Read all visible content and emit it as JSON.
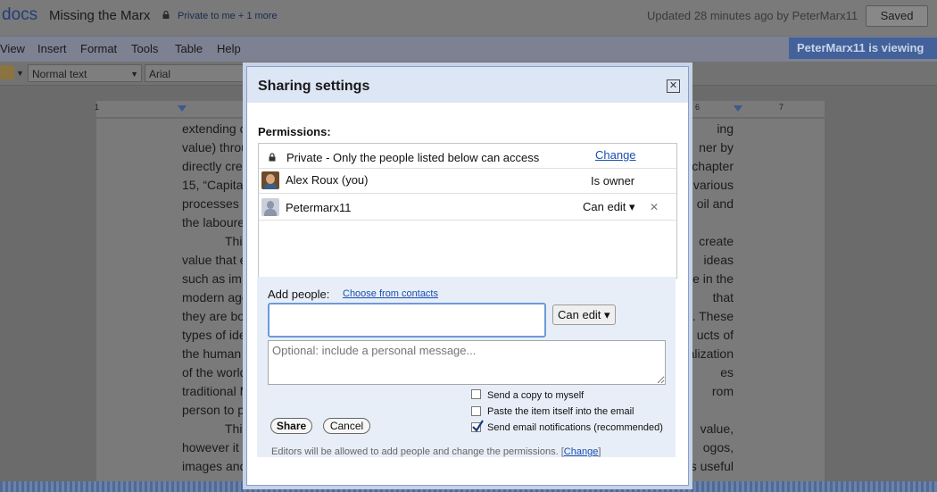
{
  "header": {
    "logo": "docs",
    "doc_title": "Missing the Marx",
    "privacy": "Private to me + 1 more",
    "updated": "Updated 28 minutes ago by PeterMarx11",
    "saved_label": "Saved"
  },
  "menu": {
    "items": [
      "View",
      "Insert",
      "Format",
      "Tools",
      "Table",
      "Help"
    ],
    "viewing_badge": "PeterMarx11 is viewing"
  },
  "toolbar": {
    "style": "Normal text",
    "font": "Arial"
  },
  "ruler": {
    "numbers": [
      "1",
      "6",
      "7"
    ]
  },
  "document": {
    "lines": [
      "extending c",
      "value) throu",
      "directly cre",
      "15, “Capita",
      "processes",
      "the laboure",
      "This",
      "value that e",
      "such as im",
      "modern age",
      "they are bo",
      "types of ide",
      "the human",
      "of the world",
      "traditional M",
      "person to p",
      "This",
      "however it",
      "images and"
    ],
    "right_lines": [
      "ing",
      "ner by",
      "chapter",
      "f various",
      "oil and",
      "",
      "create",
      "ideas",
      "e in the",
      "that",
      ". These",
      "ucts of",
      "alization",
      "es",
      "rom",
      "",
      "value,",
      "ogos,",
      "s useful"
    ]
  },
  "dialog": {
    "title": "Sharing settings",
    "close_symbol": "✕",
    "permissions_label": "Permissions:",
    "private_text": "Private - Only the people listed below can access",
    "change_link": "Change",
    "people": [
      {
        "name": "Alex Roux (you)",
        "role": "Is owner"
      },
      {
        "name": "Petermarx11",
        "role": "Can edit ▾",
        "remove": "✕"
      }
    ],
    "add_people_label": "Add people:",
    "choose_contacts": "Choose from contacts",
    "add_role": "Can edit ▾",
    "message_placeholder": "Optional: include a personal message...",
    "options": [
      {
        "label": "Send a copy to myself",
        "checked": false
      },
      {
        "label": "Paste the item itself into the email",
        "checked": false
      },
      {
        "label": "Send email notifications (recommended)",
        "checked": true
      }
    ],
    "share_label": "Share",
    "cancel_label": "Cancel",
    "footnote": "Editors will be allowed to add people and change the permissions.",
    "footnote_link": "Change"
  }
}
